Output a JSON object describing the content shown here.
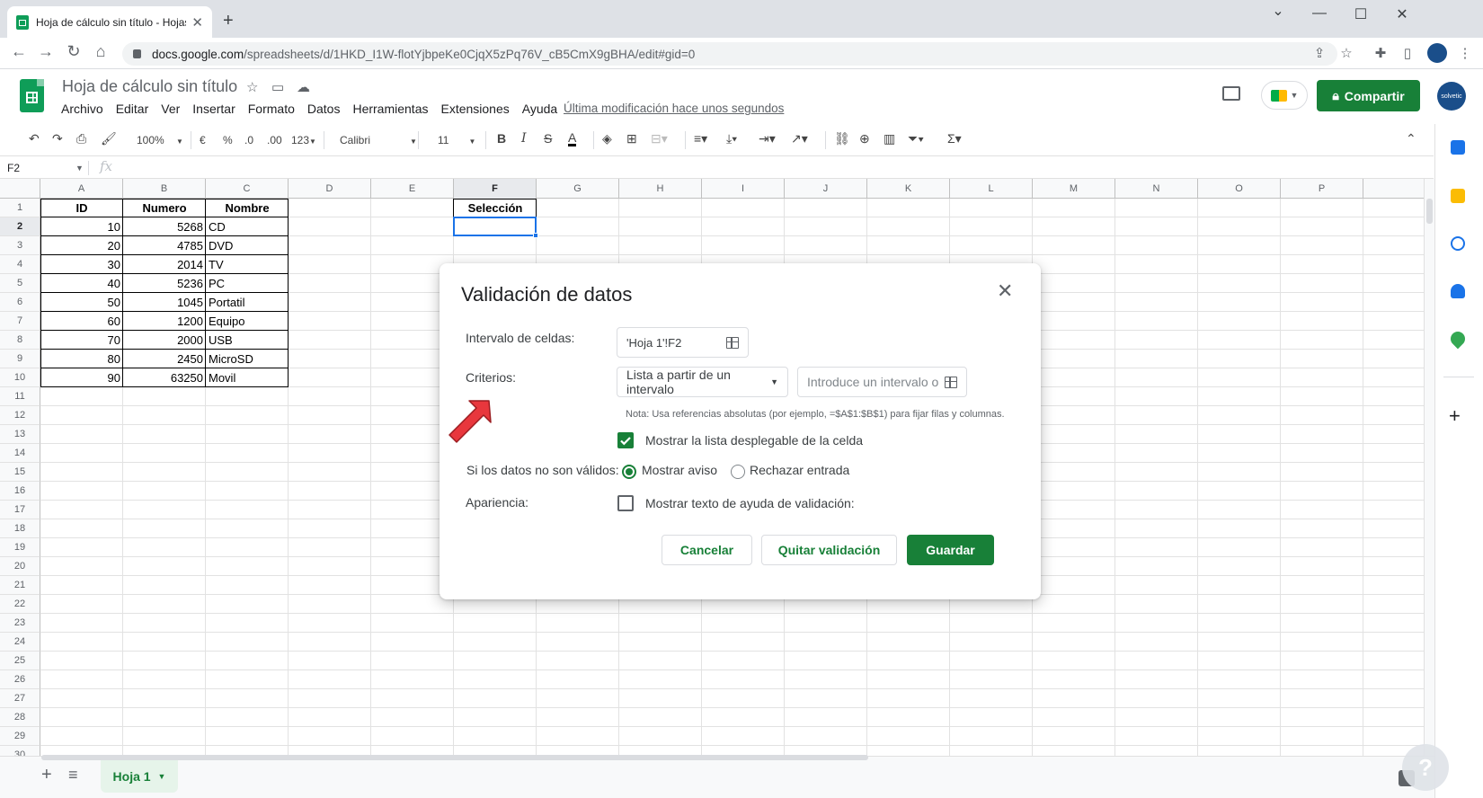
{
  "browser": {
    "tab_title": "Hoja de cálculo sin título - Hojas",
    "url_host": "docs.google.com",
    "url_path": "/spreadsheets/d/1HKD_I1W-flotYjbpeKe0CjqX5zPq76V_cB5CmX9gBHA/edit#gid=0"
  },
  "app": {
    "doc_title": "Hoja de cálculo sin título",
    "menu": [
      "Archivo",
      "Editar",
      "Ver",
      "Insertar",
      "Formato",
      "Datos",
      "Herramientas",
      "Extensiones",
      "Ayuda"
    ],
    "last_modified": "Última modificación hace unos segundos",
    "share_label": "Compartir",
    "avatar_text": "solvetic"
  },
  "toolbar": {
    "zoom": "100%",
    "currency": "€",
    "percent": "%",
    "dec_less": ".0",
    "dec_more": ".00",
    "format_more": "123",
    "font": "Calibri",
    "font_size": "11"
  },
  "formula_bar": {
    "name_box": "F2",
    "fx": "fx"
  },
  "grid": {
    "columns": [
      "A",
      "B",
      "C",
      "D",
      "E",
      "F",
      "G",
      "H",
      "I",
      "J",
      "K",
      "L",
      "M",
      "N",
      "O",
      "P"
    ],
    "selected_column": "F",
    "selected_row": 2,
    "row_count": 30,
    "headers": {
      "A": "ID",
      "B": "Numero",
      "C": "Nombre",
      "F": "Selección"
    },
    "rows": [
      {
        "id": "10",
        "numero": "5268",
        "nombre": "CD"
      },
      {
        "id": "20",
        "numero": "4785",
        "nombre": "DVD"
      },
      {
        "id": "30",
        "numero": "2014",
        "nombre": "TV"
      },
      {
        "id": "40",
        "numero": "5236",
        "nombre": "PC"
      },
      {
        "id": "50",
        "numero": "1045",
        "nombre": "Portatil"
      },
      {
        "id": "60",
        "numero": "1200",
        "nombre": "Equipo"
      },
      {
        "id": "70",
        "numero": "2000",
        "nombre": "USB"
      },
      {
        "id": "80",
        "numero": "2450",
        "nombre": "MicroSD"
      },
      {
        "id": "90",
        "numero": "63250",
        "nombre": "Movil"
      }
    ]
  },
  "sheet_tab": "Hoja 1",
  "dialog": {
    "title": "Validación de datos",
    "range_label": "Intervalo de celdas:",
    "range_value": "'Hoja 1'!F2",
    "criteria_label": "Criterios:",
    "criteria_select": "Lista a partir de un intervalo",
    "criteria_placeholder": "Introduce un intervalo o",
    "note": "Nota: Usa referencias absolutas (por ejemplo, =$A$1:$B$1) para fijar filas y columnas.",
    "show_dropdown_label": "Mostrar la lista desplegable de la celda",
    "show_dropdown_checked": true,
    "invalid_label": "Si los datos no son válidos:",
    "radio_warning": "Mostrar aviso",
    "radio_reject": "Rechazar entrada",
    "appearance_label": "Apariencia:",
    "help_text_label": "Mostrar texto de ayuda de validación:",
    "help_text_checked": false,
    "cancel": "Cancelar",
    "remove": "Quitar validación",
    "save": "Guardar"
  },
  "colors": {
    "brand_green": "#188038",
    "selection_blue": "#1a73e8",
    "arrow_red": "#e8373d"
  }
}
